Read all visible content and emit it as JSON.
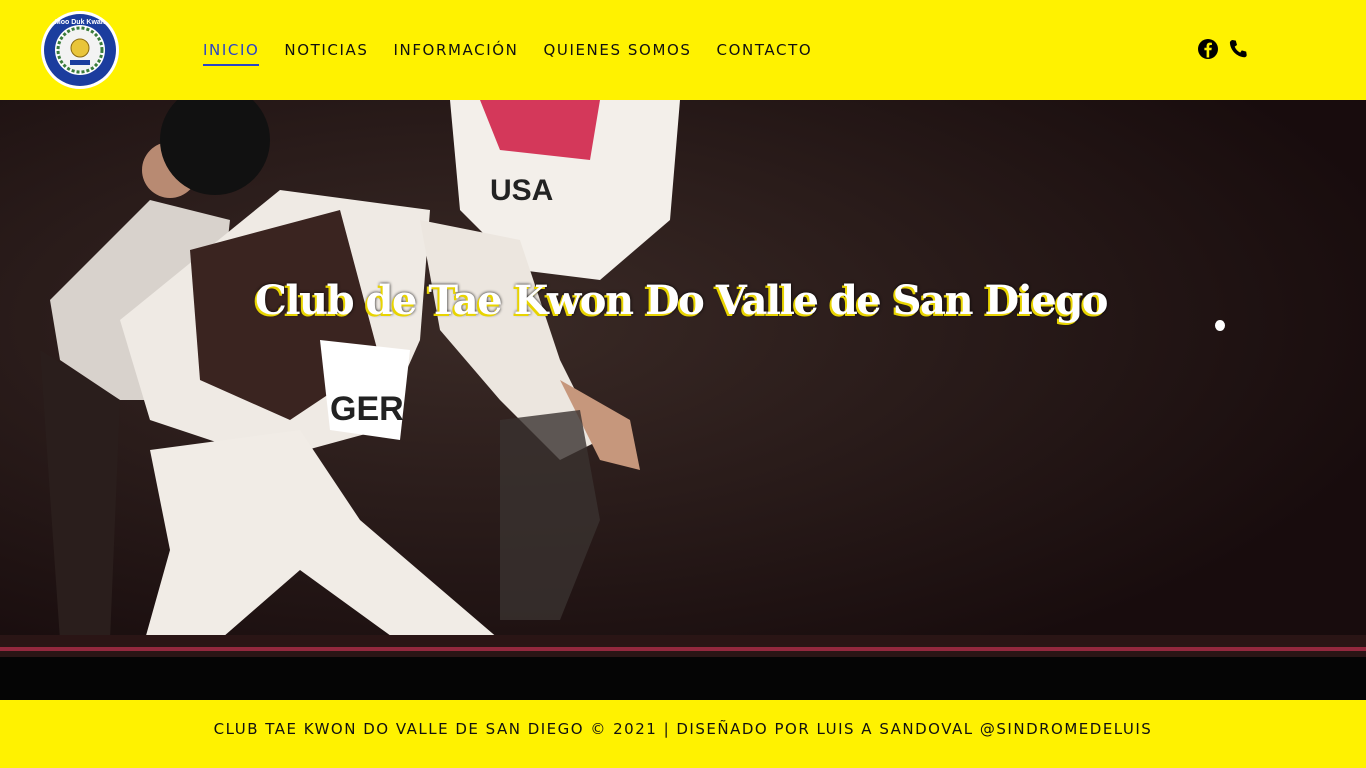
{
  "brand": {
    "logo_top_text": "Moo Duk Kwan",
    "logo_ring_text": "Club de TaeKwonDo Valle de San Diego",
    "logo_year": "2021",
    "colors": {
      "header_bg": "#fff200",
      "nav_active": "#2a44c8",
      "logo_ring": "#1b3d9e"
    }
  },
  "nav": {
    "items": [
      {
        "label": "INICIO",
        "active": true
      },
      {
        "label": "NOTICIAS"
      },
      {
        "label": "INFORMACIÓN"
      },
      {
        "label": "QUIENES SOMOS"
      },
      {
        "label": "CONTACTO"
      }
    ]
  },
  "social": {
    "icons": [
      "facebook-icon",
      "phone-icon"
    ]
  },
  "hero": {
    "title": "Club de Tae Kwon Do Valle de San Diego",
    "image_subject": "taekwondo-sparring-photo",
    "chest_labels": [
      "GER",
      "USA"
    ]
  },
  "footer": {
    "text": "CLUB TAE KWON DO VALLE DE SAN DIEGO © 2021 | DISEÑADO POR LUIS A SANDOVAL @SINDROMEDELUIS"
  }
}
